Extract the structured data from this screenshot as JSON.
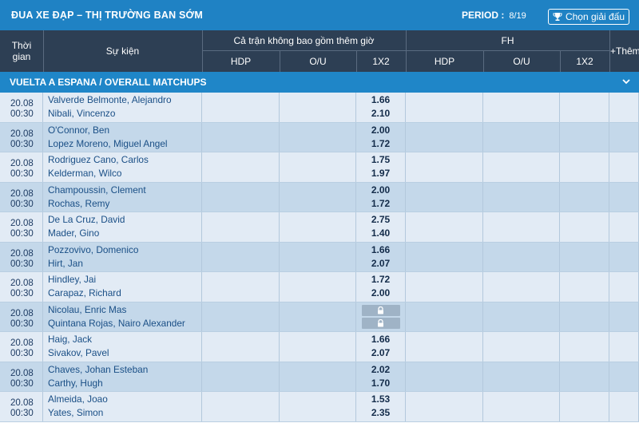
{
  "topbar": {
    "title": "ĐUA XE ĐẠP – THỊ TRƯỜNG BAN SỚM",
    "period_label": "PERIOD :",
    "period_value": "8/19",
    "choose_league": "Chọn giải đấu"
  },
  "header": {
    "time": "Thời gian",
    "event": "Sự kiện",
    "fulltime_group": "Cả trận không bao gồm thêm giờ",
    "firsthalf_group": "FH",
    "hdp": "HDP",
    "ou": "O/U",
    "x12": "1X2",
    "more": "+Thêm"
  },
  "league": {
    "name": "VUELTA A ESPANA / OVERALL MATCHUPS"
  },
  "matches": [
    {
      "date": "20.08",
      "time": "00:30",
      "home": "Valverde Belmonte, Alejandro",
      "away": "Nibali, Vincenzo",
      "o1": "1.66",
      "o2": "2.10"
    },
    {
      "date": "20.08",
      "time": "00:30",
      "home": "O'Connor, Ben",
      "away": "Lopez Moreno, Miguel Angel",
      "o1": "2.00",
      "o2": "1.72"
    },
    {
      "date": "20.08",
      "time": "00:30",
      "home": "Rodriguez Cano, Carlos",
      "away": "Kelderman, Wilco",
      "o1": "1.75",
      "o2": "1.97"
    },
    {
      "date": "20.08",
      "time": "00:30",
      "home": "Champoussin, Clement",
      "away": "Rochas, Remy",
      "o1": "2.00",
      "o2": "1.72"
    },
    {
      "date": "20.08",
      "time": "00:30",
      "home": "De La Cruz, David",
      "away": "Mader, Gino",
      "o1": "2.75",
      "o2": "1.40"
    },
    {
      "date": "20.08",
      "time": "00:30",
      "home": "Pozzovivo, Domenico",
      "away": "Hirt, Jan",
      "o1": "1.66",
      "o2": "2.07"
    },
    {
      "date": "20.08",
      "time": "00:30",
      "home": "Hindley, Jai",
      "away": "Carapaz, Richard",
      "o1": "1.72",
      "o2": "2.00"
    },
    {
      "date": "20.08",
      "time": "00:30",
      "home": "Nicolau, Enric Mas",
      "away": "Quintana Rojas, Nairo Alexander",
      "o1": "",
      "o2": "",
      "locked": true
    },
    {
      "date": "20.08",
      "time": "00:30",
      "home": "Haig, Jack",
      "away": "Sivakov, Pavel",
      "o1": "1.66",
      "o2": "2.07"
    },
    {
      "date": "20.08",
      "time": "00:30",
      "home": "Chaves, Johan Esteban",
      "away": "Carthy, Hugh",
      "o1": "2.02",
      "o2": "1.70"
    },
    {
      "date": "20.08",
      "time": "00:30",
      "home": "Almeida, Joao",
      "away": "Yates, Simon",
      "o1": "1.53",
      "o2": "2.35"
    }
  ],
  "colors": {
    "topbar": "#1f82c4",
    "header": "#2d3f54",
    "league": "#1f86c8",
    "row_light": "#e2ebf5",
    "row_dark": "#c4d8ea"
  },
  "icons": {
    "choose_league": "trophy-icon",
    "collapse": "chevron-down-icon",
    "lock": "lock-icon"
  }
}
